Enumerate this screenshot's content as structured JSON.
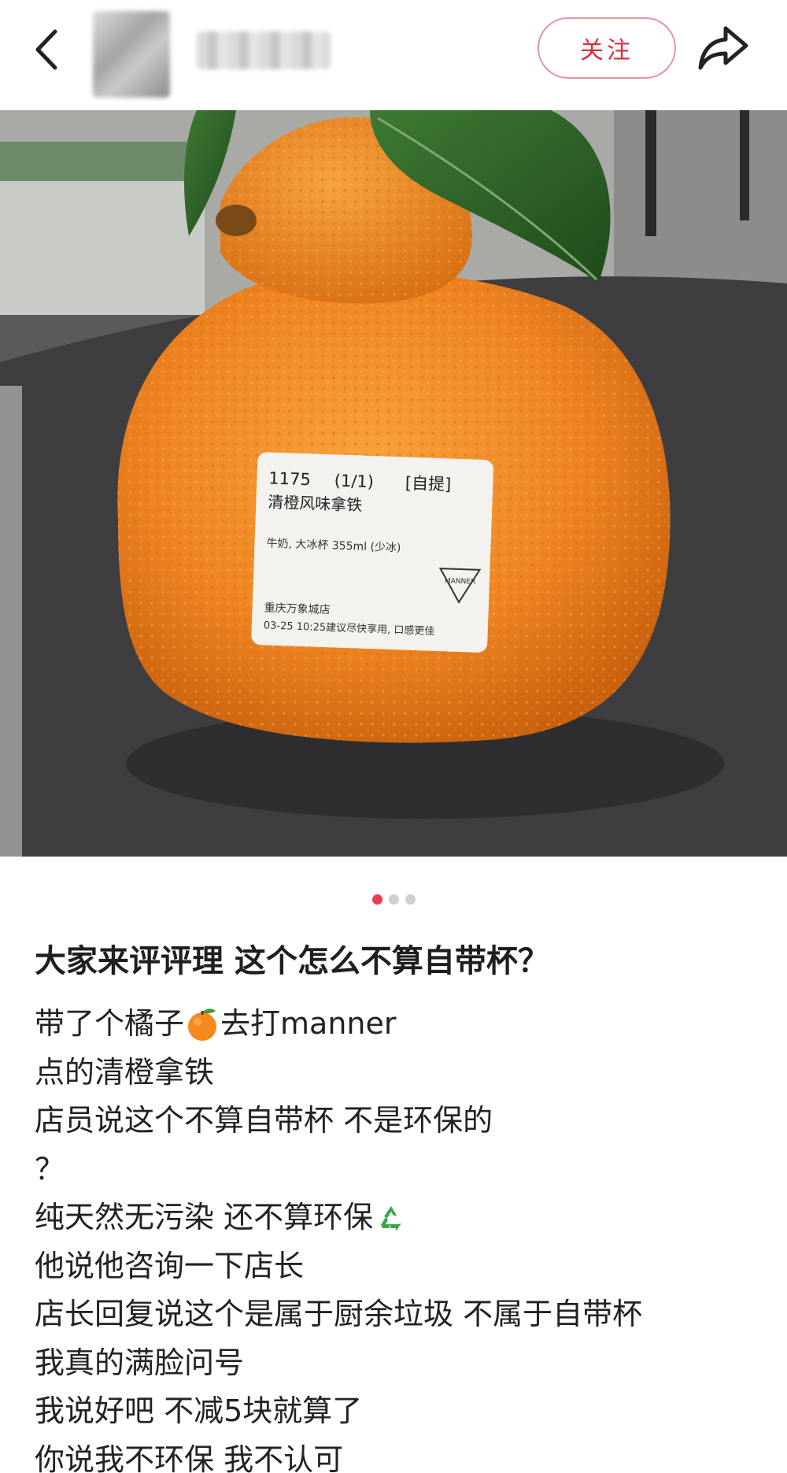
{
  "header": {
    "follow_label": "关注"
  },
  "icons": {
    "back": "chevron-left-icon",
    "share": "share-arrow-icon",
    "orange": "tangerine-emoji-icon",
    "recycle": "recycle-emoji-icon"
  },
  "photo": {
    "label": {
      "line1_num": "1175",
      "line1_count": "(1/1)",
      "line1_tag": "[自提]",
      "line2": "清橙风味拿铁",
      "line3": "牛奶, 大冰杯 355ml (少冰)",
      "brand": "MANNER",
      "line4": "重庆万象城店",
      "line5": "03-25 10:25建议尽快享用, 口感更佳"
    }
  },
  "pager": {
    "total": 3,
    "active": 1
  },
  "post": {
    "title": "大家来评评理 这个怎么不算自带杯？",
    "line1_a": "带了个橘子",
    "line1_b": "去打manner",
    "line2": "点的清橙拿铁",
    "line3": "店员说这个不算自带杯 不是环保的",
    "line4": "？",
    "line5": "纯天然无污染 还不算环保",
    "line6": "他说他咨询一下店长",
    "line7": "店长回复说这个是属于厨余垃圾 不属于自带杯",
    "line8": "我真的满脸问号",
    "line9": "我说好吧 不减5块就算了",
    "line10": "你说我不环保 我不认可"
  },
  "colors": {
    "accent": "#e0293f",
    "follow_border": "#e8939d",
    "orange": "#f08a24",
    "table": "#3f3f41"
  }
}
